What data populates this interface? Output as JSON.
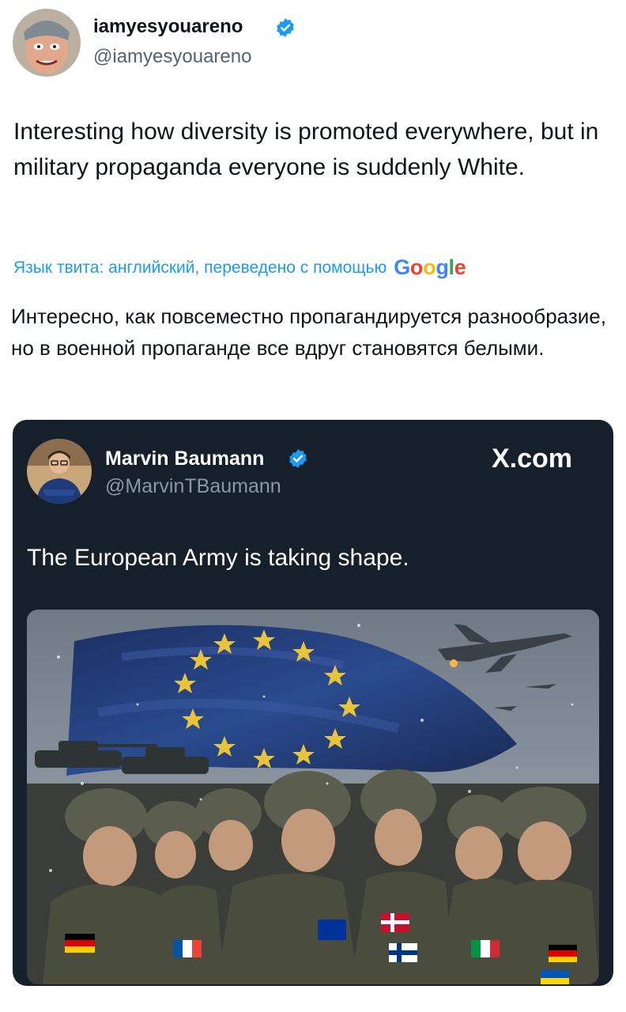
{
  "tweet": {
    "display_name": "iamyesyouareno",
    "handle": "@iamyesyouareno",
    "verified_icon": "verified-badge-icon",
    "text": "Interesting how diversity is promoted everywhere, but in military propaganda everyone is suddenly White.",
    "translation_note": "Язык твита: английский, переведено с помощью",
    "translation_provider": "Google",
    "translated_text": "Интересно, как повсеместно пропагандируется разнообразие, но в военной пропаганде все вдруг становятся белыми."
  },
  "quoted": {
    "display_name": "Marvin Baumann",
    "handle": "@MarvinTBaumann",
    "source": "X.com",
    "text": "The European Army is taking shape."
  },
  "colors": {
    "link_blue": "#1d9bf0",
    "card_bg": "#15202b",
    "muted_text": "#536471",
    "google_blue": "#4285f4",
    "google_red": "#ea4335",
    "google_yellow": "#fbbc05",
    "google_green": "#34a853"
  }
}
